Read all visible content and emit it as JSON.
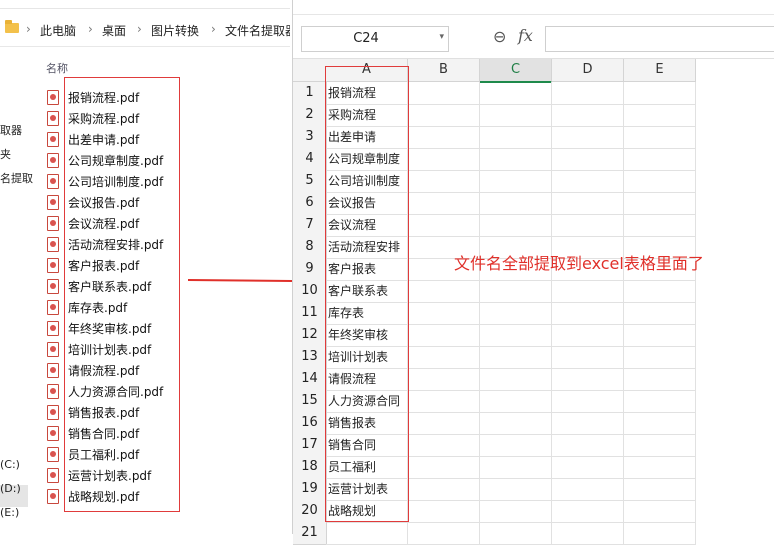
{
  "explorer": {
    "breadcrumb": [
      "此电脑",
      "桌面",
      "图片转换",
      "文件名提取器"
    ],
    "nav_items": [
      "取器",
      "夹",
      "名提取",
      "(C:)",
      "(D:)",
      "(E:)"
    ],
    "column_header": "名称",
    "files": [
      "报销流程.pdf",
      "采购流程.pdf",
      "出差申请.pdf",
      "公司规章制度.pdf",
      "公司培训制度.pdf",
      "会议报告.pdf",
      "会议流程.pdf",
      "活动流程安排.pdf",
      "客户报表.pdf",
      "客户联系表.pdf",
      "库存表.pdf",
      "年终奖审核.pdf",
      "培训计划表.pdf",
      "请假流程.pdf",
      "人力资源合同.pdf",
      "销售报表.pdf",
      "销售合同.pdf",
      "员工福利.pdf",
      "运营计划表.pdf",
      "战略规划.pdf"
    ]
  },
  "spreadsheet": {
    "name_box": "C24",
    "formula_value": "",
    "columns": [
      "A",
      "B",
      "C",
      "D",
      "E"
    ],
    "active_column": "C",
    "rows": [
      "1",
      "2",
      "3",
      "4",
      "5",
      "6",
      "7",
      "8",
      "9",
      "10",
      "11",
      "12",
      "13",
      "14",
      "15",
      "16",
      "17",
      "18",
      "19",
      "20",
      "21"
    ],
    "col_a_values": [
      "报销流程",
      "采购流程",
      "出差申请",
      "公司规章制度",
      "公司培训制度",
      "会议报告",
      "会议流程",
      "活动流程安排",
      "客户报表",
      "客户联系表",
      "库存表",
      "年终奖审核",
      "培训计划表",
      "请假流程",
      "人力资源合同",
      "销售报表",
      "销售合同",
      "员工福利",
      "运营计划表",
      "战略规划",
      ""
    ]
  },
  "annotation": {
    "text": "文件名全部提取到excel表格里面了",
    "color": "#e0302a"
  },
  "icons": {
    "folder": "folder-icon",
    "pdf": "pdf-file-icon",
    "zoom": "zoom-icon",
    "fx": "function-icon",
    "arrow": "red-arrow-icon"
  }
}
